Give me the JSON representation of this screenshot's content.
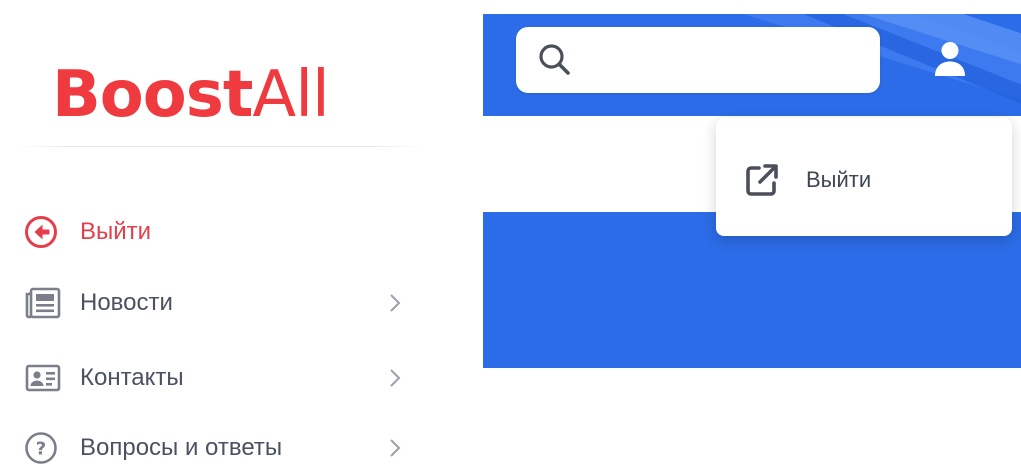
{
  "brand": {
    "name_bold": "Boost",
    "name_light": "All",
    "color": "#ef3b3f"
  },
  "sidebar": {
    "items": [
      {
        "label": "Выйти",
        "icon": "arrow-left-circle-icon",
        "color": "#e53d4c",
        "has_chevron": false
      },
      {
        "label": "Новости",
        "icon": "newspaper-icon",
        "has_chevron": true
      },
      {
        "label": "Контакты",
        "icon": "contact-card-icon",
        "has_chevron": true
      },
      {
        "label": "Вопросы и ответы",
        "icon": "question-circle-icon",
        "has_chevron": true
      }
    ]
  },
  "header": {
    "search": {
      "placeholder": "",
      "value": "",
      "icon": "search-icon"
    },
    "user_icon": "user-icon",
    "background_color": "#2c6ce8"
  },
  "user_menu": {
    "items": [
      {
        "label": "Выйти",
        "icon": "external-link-icon"
      }
    ]
  },
  "colors": {
    "text": "#4b5160",
    "accent_red": "#e53d4c",
    "header_blue": "#2c6ce8"
  }
}
